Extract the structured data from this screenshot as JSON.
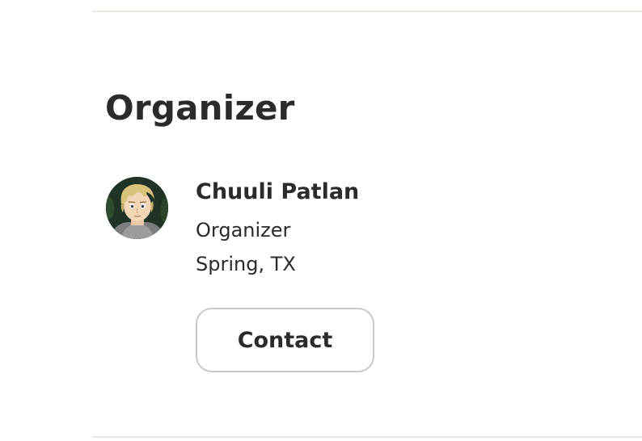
{
  "section": {
    "title": "Organizer"
  },
  "organizer": {
    "avatar_icon": "organizer-avatar-portrait",
    "name": "Chuuli Patlan",
    "role": "Organizer",
    "location": "Spring, TX"
  },
  "actions": {
    "contact_label": "Contact"
  },
  "colors": {
    "text": "#2b2b2b",
    "divider": "#e8e6df",
    "button_border": "#c9c9c9",
    "background": "#ffffff"
  }
}
